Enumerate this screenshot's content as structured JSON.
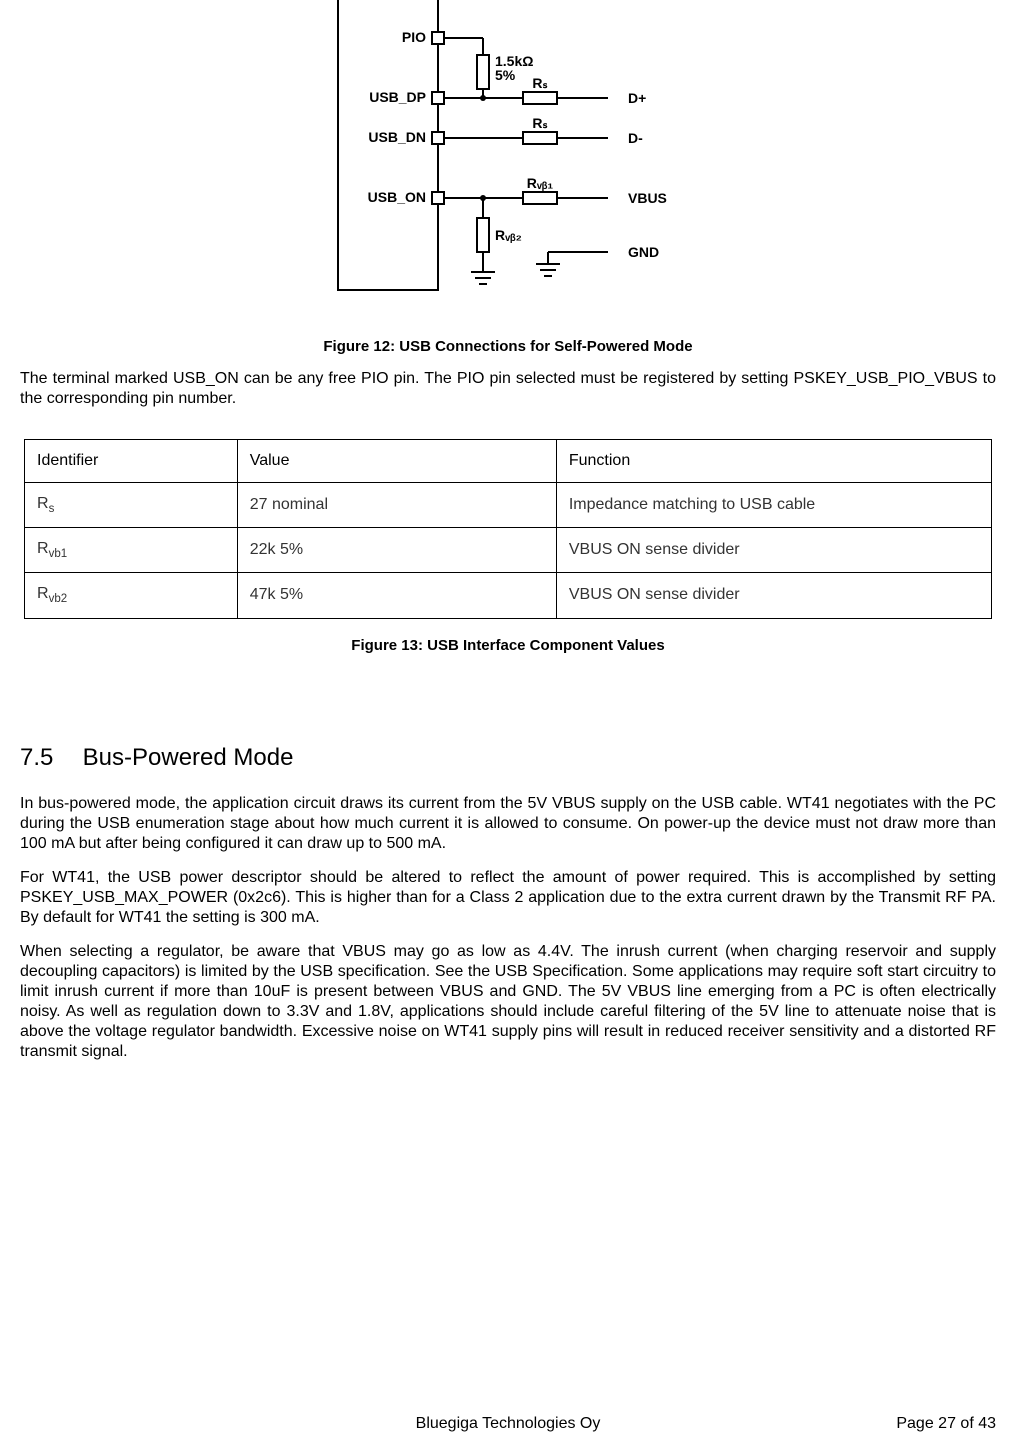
{
  "diagram": {
    "pin_pio": "PIO",
    "pin_usb_dp": "USB_DP",
    "pin_usb_dn": "USB_DN",
    "pin_usb_on": "USB_ON",
    "label_1_5k": "1.5kΩ",
    "label_5pct": "5%",
    "label_rs1": "Rₛ",
    "label_rs2": "Rₛ",
    "label_dplus": "D+",
    "label_dminus": "D-",
    "label_rvb1": "Rᵥᵦ₁",
    "label_vbus": "VBUS",
    "label_rvb2": "Rᵥᵦ₂",
    "label_gnd": "GND"
  },
  "fig12_caption": "Figure 12: USB Connections for Self-Powered Mode",
  "para1": "The terminal marked USB_ON can be any free PIO pin. The PIO pin selected must be registered by setting PSKEY_USB_PIO_VBUS to the corresponding pin number.",
  "table_headers": {
    "id": "Identifier",
    "val": "Value",
    "fn": "Function"
  },
  "table_rows": [
    {
      "id_html": "R<sub>s</sub>",
      "val": "27 nominal",
      "fn": "Impedance matching to USB cable"
    },
    {
      "id_html": "R<sub>vb1</sub>",
      "val": "22k 5%",
      "fn": "VBUS ON sense divider"
    },
    {
      "id_html": "R<sub>vb2</sub>",
      "val": "47k 5%",
      "fn": "VBUS ON sense divider"
    }
  ],
  "fig13_caption": "Figure 13: USB Interface Component Values",
  "section_num": "7.5",
  "section_title": "Bus-Powered Mode",
  "para2": "In bus-powered mode, the application circuit draws its current from the 5V VBUS supply on the USB cable. WT41 negotiates with the PC during the USB enumeration stage about how much current it is allowed to consume. On power-up the device must not draw more than 100 mA but after being configured it can draw up to 500 mA.",
  "para3": "For WT41, the USB power descriptor should be altered to reflect the amount of power required. This is accomplished by setting PSKEY_USB_MAX_POWER (0x2c6). This is higher than for a Class 2 application due to the extra current drawn by the Transmit RF PA. By default for WT41 the setting is 300 mA.",
  "para4": "When selecting a regulator, be aware that VBUS may go as low as 4.4V. The inrush current (when charging reservoir and supply decoupling capacitors) is limited by the USB specification. See the USB Specification. Some applications may require soft start circuitry to limit inrush current if more than 10uF is present between VBUS and GND. The 5V VBUS line emerging from a PC is often electrically noisy. As well as regulation down to 3.3V and 1.8V, applications should include careful filtering of the 5V line to attenuate noise that is above the voltage regulator bandwidth. Excessive noise on WT41 supply pins will result in reduced receiver sensitivity and a distorted RF transmit signal.",
  "footer_company": "Bluegiga Technologies Oy",
  "page_label": "Page 27 of 43"
}
